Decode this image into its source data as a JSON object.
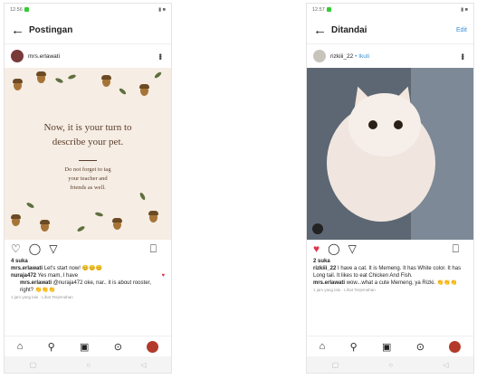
{
  "left": {
    "status_time": "12.56",
    "status_icons": "▮ ■",
    "title": "Postingan",
    "username": "mrs.erlawati",
    "post": {
      "headline_1": "Now, it is your turn to",
      "headline_2": "describe your pet.",
      "sub_1": "Do not forget to tag",
      "sub_2": "your teacher and",
      "sub_3": "friends as well."
    },
    "likes": "4 suka",
    "comments": [
      {
        "user": "mrs.erlawati",
        "text": "Let's start now! 😊😊😊"
      },
      {
        "user": "nuraja472",
        "text": "Yes mam, I have"
      },
      {
        "user": "mrs.erlawati",
        "text": "@nuraja472 oke, nar.. it is about rooster, right? 👏👏👏"
      }
    ],
    "more": "1 jam yang lalu · Lihat Terjemahan"
  },
  "right": {
    "status_time": "12.57",
    "status_icons": "▮ ■",
    "title": "Ditandai",
    "edit": "Edit",
    "username": "rizkiii_22",
    "sub": "• Ikuti",
    "likes": "2 suka",
    "comments": [
      {
        "user": "rizkiii_22",
        "text": "I have a cat. It is Memeng. It has White color. It has Long tail. It likes to eat Chicken And Fish."
      },
      {
        "user": "mrs.erlawati",
        "text": "wow...what a cute Memeng, ya Rizki. 👏👏👏"
      }
    ],
    "more": "1 jam yang lalu · Lihat Terjemahan"
  },
  "nav_icons": [
    "home-icon",
    "search-icon",
    "reels-icon",
    "shop-icon",
    "profile-avatar"
  ]
}
